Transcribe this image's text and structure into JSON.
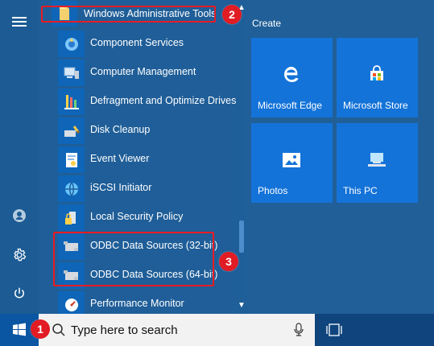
{
  "colors": {
    "start_bg": "#1e5d97",
    "tile_blue": "#1473d8",
    "list_blue": "#1f5e98",
    "taskbar": "#0f447d",
    "highlight_red": "#e81c23",
    "badge_red": "#e11c24"
  },
  "rail": {
    "menu_icon": "hamburger-icon",
    "user_icon": "user-icon",
    "settings_icon": "gear-icon",
    "power_icon": "power-icon"
  },
  "folder": {
    "label": "Windows Administrative Tools",
    "icon": "folder-icon"
  },
  "apps": [
    {
      "label": "Component Services",
      "icon": "component-services-icon"
    },
    {
      "label": "Computer Management",
      "icon": "computer-management-icon"
    },
    {
      "label": "Defragment and Optimize Drives",
      "icon": "defragment-icon"
    },
    {
      "label": "Disk Cleanup",
      "icon": "disk-cleanup-icon"
    },
    {
      "label": "Event Viewer",
      "icon": "event-viewer-icon"
    },
    {
      "label": "iSCSI Initiator",
      "icon": "iscsi-icon"
    },
    {
      "label": "Local Security Policy",
      "icon": "security-policy-icon"
    },
    {
      "label": "ODBC Data Sources (32-bit)",
      "icon": "odbc-icon"
    },
    {
      "label": "ODBC Data Sources (64-bit)",
      "icon": "odbc-icon"
    },
    {
      "label": "Performance Monitor",
      "icon": "performance-monitor-icon"
    }
  ],
  "tiles": {
    "section_title": "Create",
    "items": [
      {
        "label": "Microsoft Edge",
        "icon": "edge-icon"
      },
      {
        "label": "Microsoft Store",
        "icon": "store-icon"
      },
      {
        "label": "Photos",
        "icon": "photos-icon"
      },
      {
        "label": "This PC",
        "icon": "pc-icon"
      }
    ]
  },
  "taskbar": {
    "search_placeholder": "Type here to search",
    "start_icon": "windows-logo-icon",
    "search_icon": "search-icon",
    "mic_icon": "microphone-icon",
    "task_view_icon": "task-view-icon"
  },
  "annotations": [
    {
      "number": "1"
    },
    {
      "number": "2"
    },
    {
      "number": "3"
    }
  ]
}
